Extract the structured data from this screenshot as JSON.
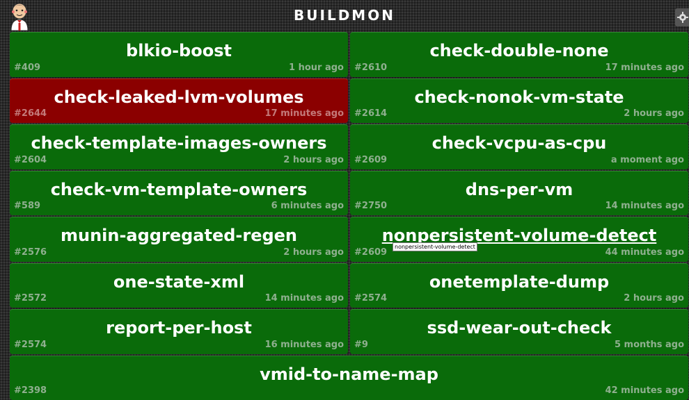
{
  "header": {
    "title": "BUILDMON",
    "logo_icon": "jenkins-butler-icon",
    "settings_icon": "gear-icon"
  },
  "jobs": [
    {
      "name": "blkio-boost",
      "build": "#409",
      "ago": "1 hour ago",
      "status": "success"
    },
    {
      "name": "check-double-none",
      "build": "#2610",
      "ago": "17 minutes ago",
      "status": "success"
    },
    {
      "name": "check-leaked-lvm-volumes",
      "build": "#2644",
      "ago": "17 minutes ago",
      "status": "failed"
    },
    {
      "name": "check-nonok-vm-state",
      "build": "#2614",
      "ago": "2 hours ago",
      "status": "success"
    },
    {
      "name": "check-template-images-owners",
      "build": "#2604",
      "ago": "2 hours ago",
      "status": "success"
    },
    {
      "name": "check-vcpu-as-cpu",
      "build": "#2609",
      "ago": "a moment ago",
      "status": "success"
    },
    {
      "name": "check-vm-template-owners",
      "build": "#589",
      "ago": "6 minutes ago",
      "status": "success"
    },
    {
      "name": "dns-per-vm",
      "build": "#2750",
      "ago": "14 minutes ago",
      "status": "success"
    },
    {
      "name": "munin-aggregated-regen",
      "build": "#2576",
      "ago": "2 hours ago",
      "status": "success"
    },
    {
      "name": "nonpersistent-volume-detect",
      "build": "#2609",
      "ago": "44 minutes ago",
      "status": "success"
    },
    {
      "name": "one-state-xml",
      "build": "#2572",
      "ago": "14 minutes ago",
      "status": "success"
    },
    {
      "name": "onetemplate-dump",
      "build": "#2574",
      "ago": "2 hours ago",
      "status": "success"
    },
    {
      "name": "report-per-host",
      "build": "#2574",
      "ago": "16 minutes ago",
      "status": "success"
    },
    {
      "name": "ssd-wear-out-check",
      "build": "#9",
      "ago": "5 months ago",
      "status": "success"
    },
    {
      "name": "vmid-to-name-map",
      "build": "#2398",
      "ago": "42 minutes ago",
      "status": "success"
    }
  ],
  "tooltip": {
    "text": "nonpersistent-volume-detect"
  },
  "colors": {
    "success": "#0a6b0a",
    "failed": "#8b0000",
    "background": "#2a2a2a"
  }
}
